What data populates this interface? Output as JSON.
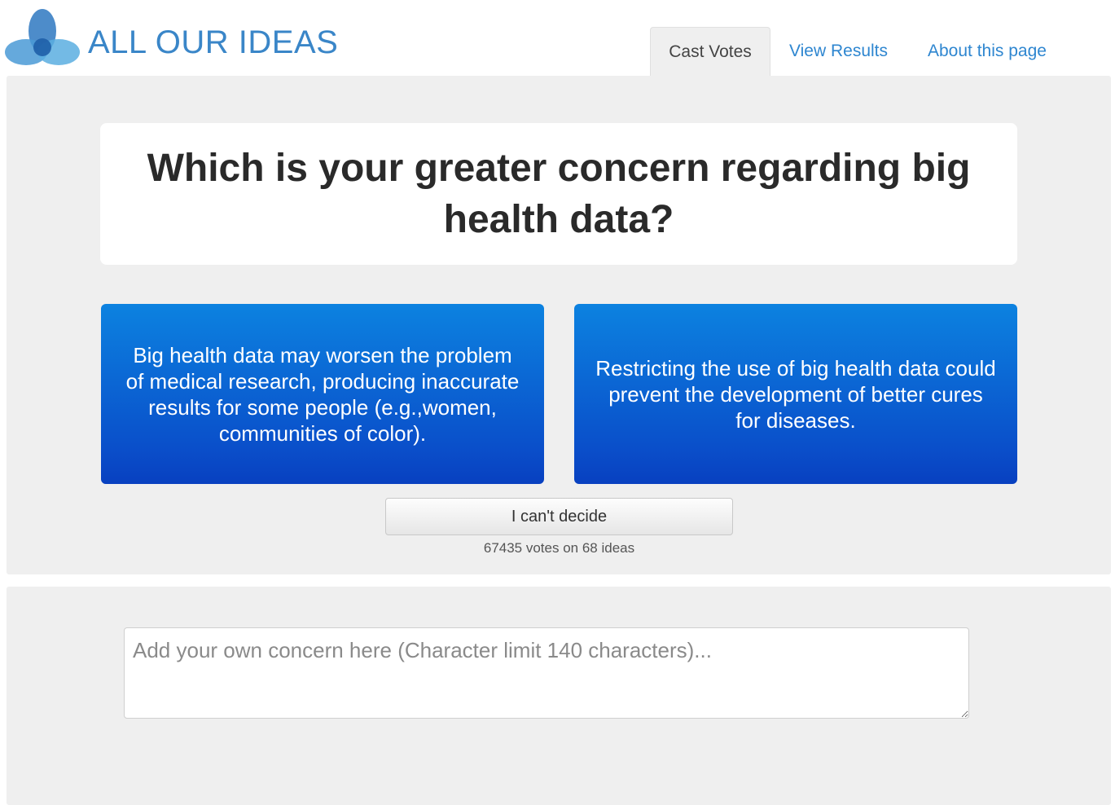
{
  "brand": {
    "logo_text": "ALL OUR IDEAS",
    "logo_icon": "three-petal-logo-icon"
  },
  "nav": {
    "tabs": [
      {
        "label": "Cast Votes",
        "active": true
      },
      {
        "label": "View Results",
        "active": false
      },
      {
        "label": "About this page",
        "active": false
      }
    ]
  },
  "question": {
    "text": "Which is your greater concern regarding big health data?"
  },
  "choices": {
    "left": "Big health data may worsen the problem of medical research, producing inaccurate results for some people (e.g.,women, communities of color).",
    "right": "Restricting the use of big health data could prevent the development of better cures for diseases."
  },
  "cant_decide_label": "I can't decide",
  "vote_stats": "67435 votes on 68 ideas",
  "new_idea": {
    "placeholder": "Add your own concern here (Character limit 140 characters)...",
    "value": ""
  },
  "colors": {
    "brand_blue": "#3a86c8",
    "link_blue": "#2e86d0",
    "choice_top": "#0c82e0",
    "choice_bottom": "#0840c0",
    "panel_bg": "#efefef"
  }
}
